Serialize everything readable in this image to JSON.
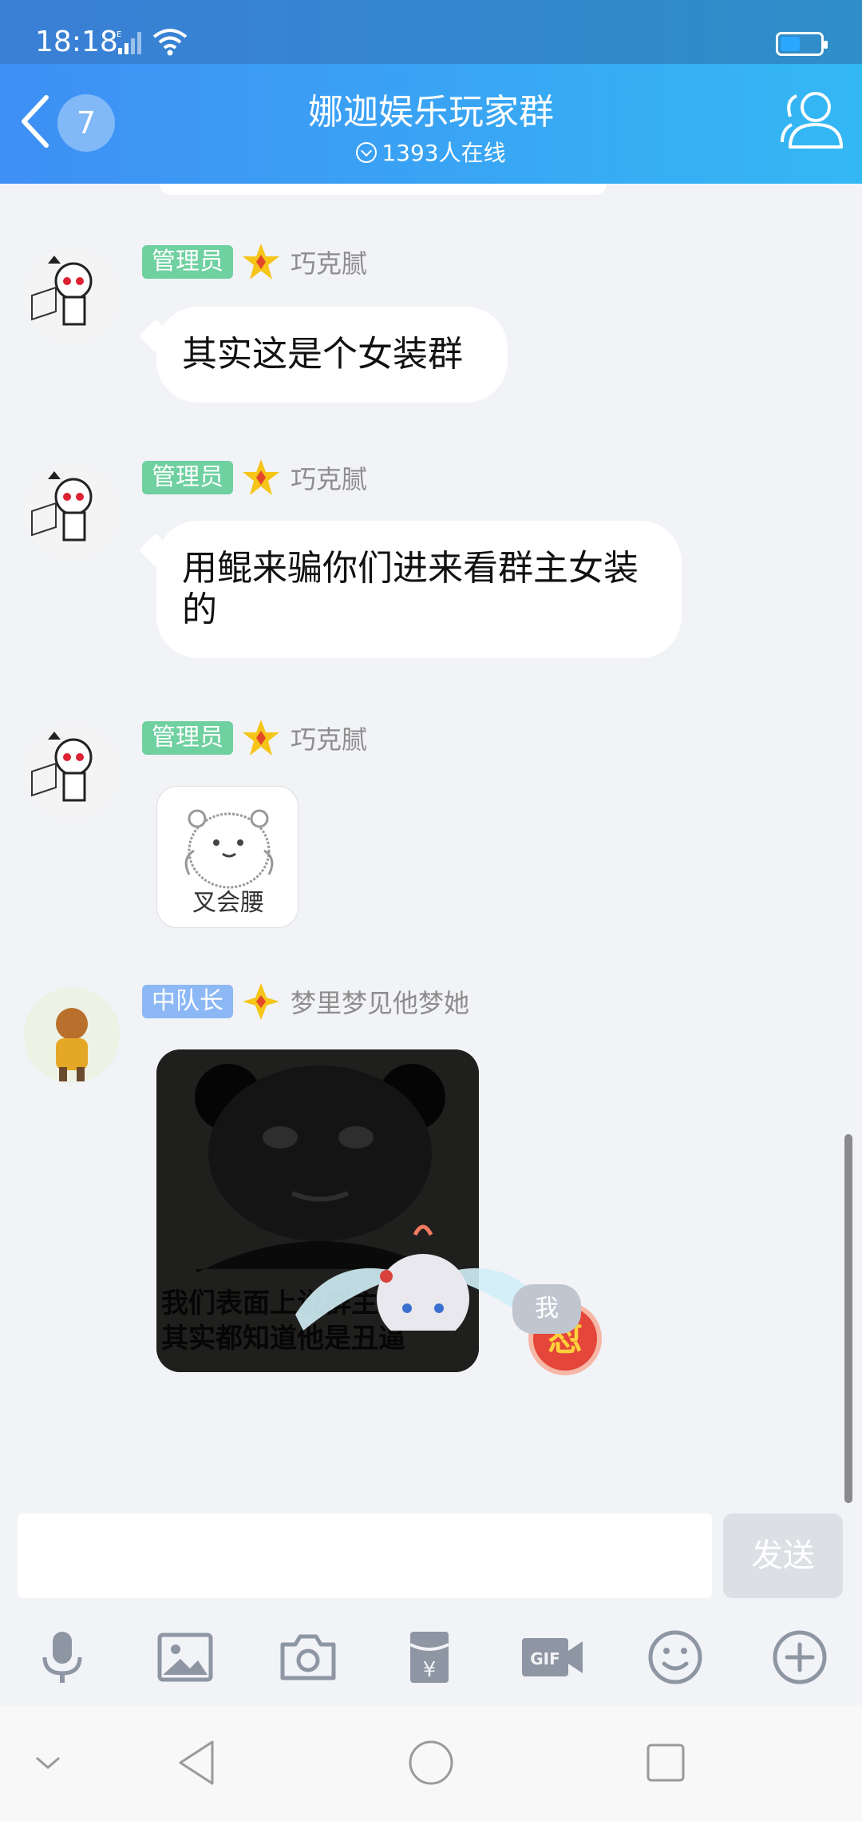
{
  "status_bar": {
    "time": "18:18",
    "network": "E"
  },
  "header": {
    "unread_count": "7",
    "group_name": "娜迦娱乐玩家群",
    "online_text": "1393人在线"
  },
  "messages": [
    {
      "role": "管理员",
      "sender": "巧克腻",
      "text": "其实这是个女装群"
    },
    {
      "role": "管理员",
      "sender": "巧克腻",
      "text": "用鲲来骗你们进来看群主女装的"
    },
    {
      "role": "管理员",
      "sender": "巧克腻",
      "sticker_caption": "叉会腰"
    },
    {
      "role": "中队长",
      "sender": "梦里梦见他梦她",
      "sticker_caption_line1": "我们表面上说群主真帅",
      "sticker_caption_line2": "其实都知道他是丑逼",
      "reaction": "怼"
    }
  ],
  "me_badge": "我",
  "composer": {
    "placeholder": "",
    "send_label": "发送"
  },
  "toolbar_icons": [
    "mic-icon",
    "image-icon",
    "camera-icon",
    "red-packet-icon",
    "gif-icon",
    "emoji-icon",
    "plus-icon"
  ],
  "colors": {
    "header_start": "#3f8ff4",
    "header_end": "#34b8f4",
    "admin_badge": "#6fd0a0",
    "captain_badge": "#8cb8f5"
  }
}
